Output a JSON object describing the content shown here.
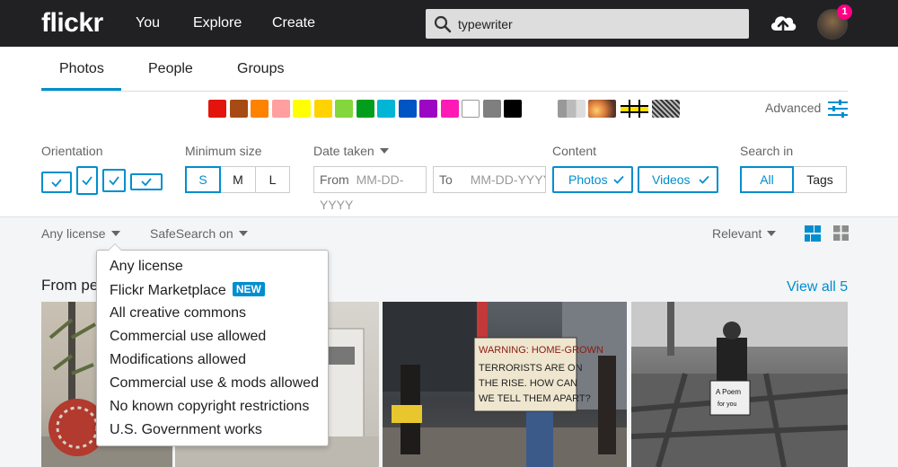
{
  "header": {
    "logo": "flickr",
    "nav": [
      "You",
      "Explore",
      "Create"
    ],
    "search_value": "typewriter",
    "notification_count": "1"
  },
  "tabs": [
    "Photos",
    "People",
    "Groups"
  ],
  "colors": [
    "#e3140d",
    "#a64b14",
    "#ff8200",
    "#ff9f9f",
    "#ffff00",
    "#ffd200",
    "#83d63c",
    "#009e1c",
    "#00b5d5",
    "#0055c4",
    "#9c07c3",
    "#ff1ab5",
    "#ffffff",
    "#7f7f7f",
    "#000000"
  ],
  "advanced_label": "Advanced",
  "filters": {
    "orientation_label": "Orientation",
    "min_size_label": "Minimum size",
    "sizes": [
      "S",
      "M",
      "L"
    ],
    "date_taken_label": "Date taken",
    "from_prefix": "From",
    "to_prefix": "To",
    "date_placeholder": "MM-DD-YYYY",
    "content_label": "Content",
    "content_photos": "Photos",
    "content_videos": "Videos",
    "search_in_label": "Search in",
    "search_in_all": "All",
    "search_in_tags": "Tags"
  },
  "toolbar": {
    "license": "Any license",
    "safesearch": "SafeSearch on",
    "sort": "Relevant"
  },
  "section": {
    "title": "From pe",
    "view_all": "View all 5"
  },
  "license_menu": {
    "items": [
      "Any license",
      "Flickr Marketplace",
      "All creative commons",
      "Commercial use allowed",
      "Modifications allowed",
      "Commercial use & mods allowed",
      "No known copyright restrictions",
      "U.S. Government works"
    ],
    "new_badge": "NEW"
  },
  "photo_sign": {
    "line1": "WARNING: HOME-GROWN",
    "line2": "TERRORISTS ARE ON",
    "line3": "THE RISE. HOW CAN",
    "line4": "WE TELL THEM APART?"
  },
  "photo_poem": {
    "line1": "A Poem",
    "line2": "for you"
  }
}
